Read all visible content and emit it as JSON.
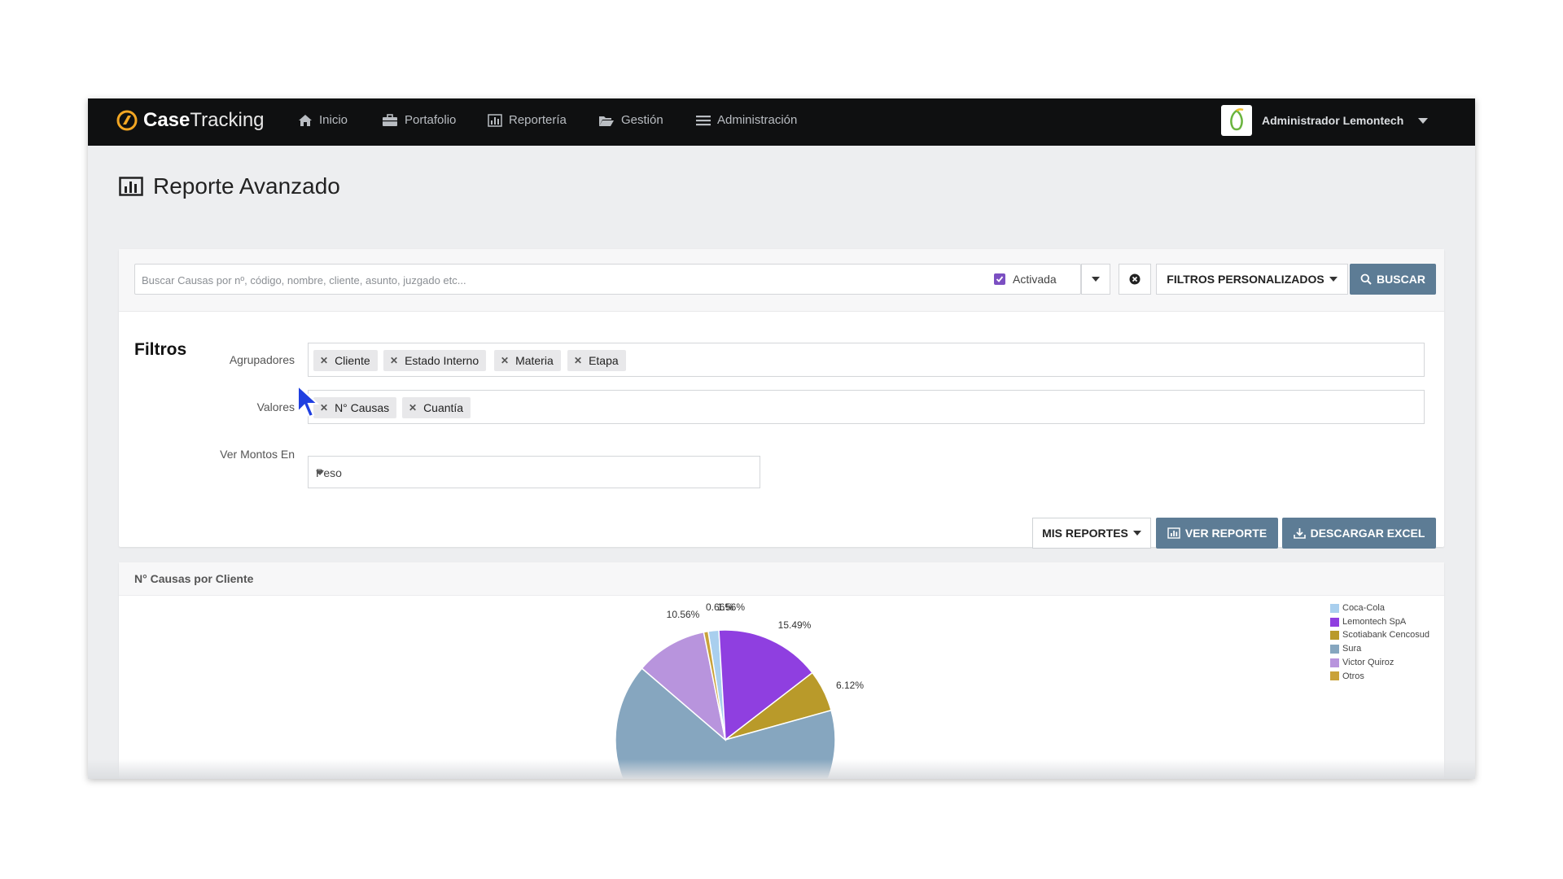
{
  "brand": {
    "part1": "Case",
    "part2": "Tracking"
  },
  "nav": {
    "items": [
      {
        "label": "Inicio",
        "icon": "home-icon"
      },
      {
        "label": "Portafolio",
        "icon": "briefcase-icon"
      },
      {
        "label": "Reportería",
        "icon": "bar-chart-icon"
      },
      {
        "label": "Gestión",
        "icon": "folder-open-icon"
      },
      {
        "label": "Administración",
        "icon": "menu-icon"
      }
    ],
    "user": "Administrador Lemontech"
  },
  "page": {
    "title": "Reporte Avanzado"
  },
  "search": {
    "placeholder": "Buscar Causas por nº, código, nombre, cliente, asunto, juzgado etc...",
    "value": "",
    "activada_label": "Activada",
    "activada_checked": true,
    "filtros_label": "FILTROS PERSONALIZADOS",
    "buscar_label": "BUSCAR"
  },
  "filters": {
    "title": "Filtros",
    "agrupadores_label": "Agrupadores",
    "agrupadores": [
      "Cliente",
      "Estado Interno",
      "Materia",
      "Etapa"
    ],
    "valores_label": "Valores",
    "valores": [
      "N° Causas",
      "Cuantía"
    ],
    "montos_label": "Ver Montos En",
    "montos_value": "Peso"
  },
  "actions": {
    "mis_reportes": "MIS REPORTES",
    "ver_reporte": "VER REPORTE",
    "descargar_excel": "DESCARGAR EXCEL"
  },
  "colors": {
    "accent": "#5d7c95",
    "navbar": "#0f1011",
    "checkbox": "#7b4fc2"
  },
  "chart_data": {
    "type": "pie",
    "title": "N° Causas por Cliente",
    "legend_position": "top-right",
    "categories": [
      "Coca-Cola",
      "Lemontech SpA",
      "Scotiabank Cencosud",
      "Sura",
      "Victor Quiroz",
      "Otros"
    ],
    "values": [
      1.56,
      15.49,
      6.12,
      65.61,
      10.56,
      0.66
    ],
    "visible_labels": [
      "0.66%",
      "1.56%",
      "15.49%",
      "6.12%",
      "10.56%"
    ],
    "colors": [
      "#a9cfee",
      "#8f3fe0",
      "#b99a2a",
      "#86a6bf",
      "#b894dd",
      "#c9a23a"
    ]
  }
}
